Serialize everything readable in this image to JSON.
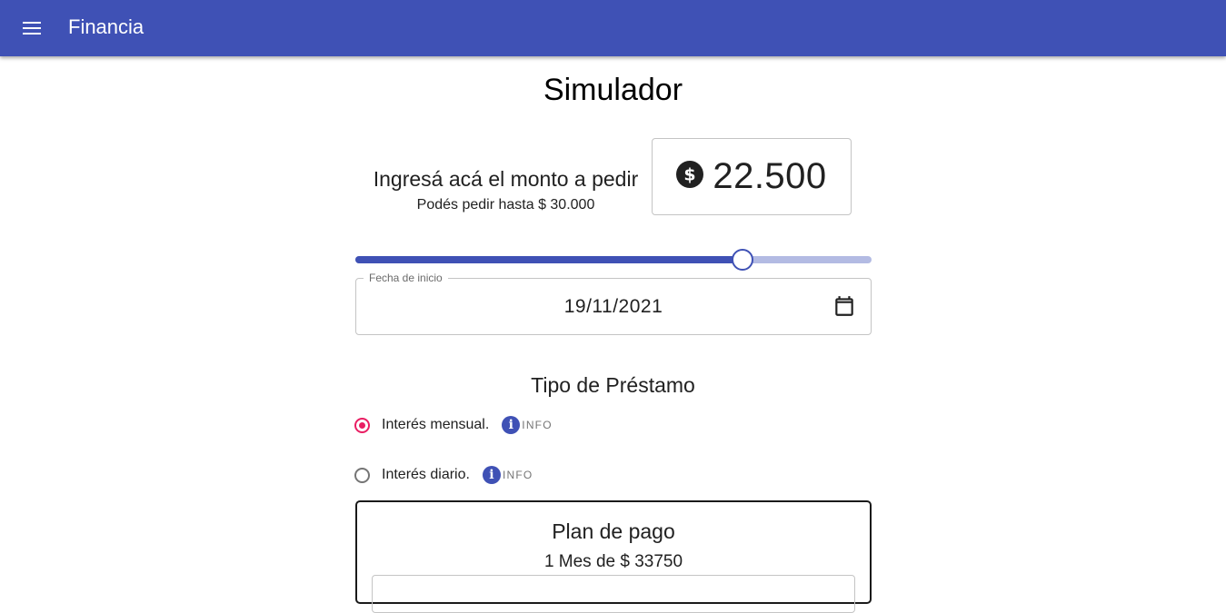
{
  "app": {
    "title": "Financia"
  },
  "page": {
    "title": "Simulador"
  },
  "amount": {
    "label": "Ingresá acá el monto a pedir",
    "max_text": "Podés pedir hasta $ 30.000",
    "value": "22.500"
  },
  "slider": {
    "value": 22500,
    "max": 30000,
    "fraction": 0.75
  },
  "date": {
    "legend": "Fecha de inicio",
    "value": "19/11/2021"
  },
  "loan_type": {
    "heading": "Tipo de Préstamo",
    "options": [
      {
        "label": "Interés mensual.",
        "info": "INFO",
        "selected": true
      },
      {
        "label": "Interés diario.",
        "info": "INFO",
        "selected": false
      }
    ]
  },
  "plan": {
    "title": "Plan de pago",
    "detail": "1 Mes de $ 33750"
  },
  "colors": {
    "primary": "#3f51b5",
    "accent": "#e91e63",
    "slider_rail": "#b3bbe3"
  }
}
